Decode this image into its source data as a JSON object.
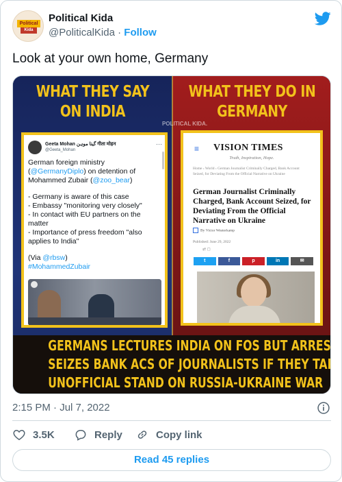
{
  "author": {
    "name": "Political Kida",
    "handle": "@PoliticalKida",
    "separator": "·",
    "follow_label": "Follow",
    "avatar_text_top": "Political",
    "avatar_text_bottom": "Kida"
  },
  "tweet": {
    "text": "Look at your own home, Germany",
    "timestamp": "2:15 PM · Jul 7, 2022"
  },
  "media": {
    "left_heading": "WHAT THEY SAY ON INDIA",
    "right_heading": "WHAT THEY DO IN GERMANY",
    "watermark": "POLITICAL KIDA.",
    "banner_lines": [
      "GERMANS LECTURES INDIA ON FOS BUT ARRESTS AND",
      "SEIZES BANK ACS OF JOURNALISTS IF THEY TAKE",
      "UNOFFICIAL STAND ON RUSSIA-UKRAINE WAR"
    ],
    "embedded_tweet": {
      "name": "Geeta Mohan گیتا موہن गीता मोहन",
      "handle": "@Geeta_Mohan",
      "para1_a": "German foreign ministry (",
      "para1_link1": "@GermanyDiplo",
      "para1_b": ") on detention of Mohammed Zubair (",
      "para1_link2": "@zoo_bear",
      "para1_c": ")",
      "bullets": [
        "- Germany is aware of this case",
        "- Embassy \"monitoring very closely\"",
        "- In contact with EU partners on the matter",
        "- Importance of press freedom \"also applies to India\""
      ],
      "via_prefix": "(Via ",
      "via_link": "@rbsw",
      "via_suffix": ")",
      "hashtag": "#MohammedZubair"
    },
    "article": {
      "site_title": "VISION TIMES",
      "tagline": "Truth, Inspiration, Hope.",
      "breadcrumb": "Home › World › German Journalist Criminally Charged, Bank Account Seized, for Deviating From the Official Narrative on Ukraine",
      "headline": "German Journalist Criminally Charged, Bank Account Seized, for Deviating From the Official Narrative on Ukraine",
      "byline": "By Victor Westerkamp",
      "date": "Published: June 29, 2022",
      "share_buttons": [
        "twitter",
        "facebook",
        "pinterest",
        "linkedin",
        "email"
      ],
      "share_colors": [
        "#1da1f2",
        "#3b5998",
        "#cb2027",
        "#0077b5",
        "#555555"
      ]
    }
  },
  "actions": {
    "like_count": "3.5K",
    "reply_label": "Reply",
    "copy_label": "Copy link",
    "read_replies": "Read 45 replies"
  },
  "colors": {
    "accent": "#1d9bf0",
    "muted": "#536471",
    "heart": "#536471",
    "banner_text": "#f2c21b"
  }
}
